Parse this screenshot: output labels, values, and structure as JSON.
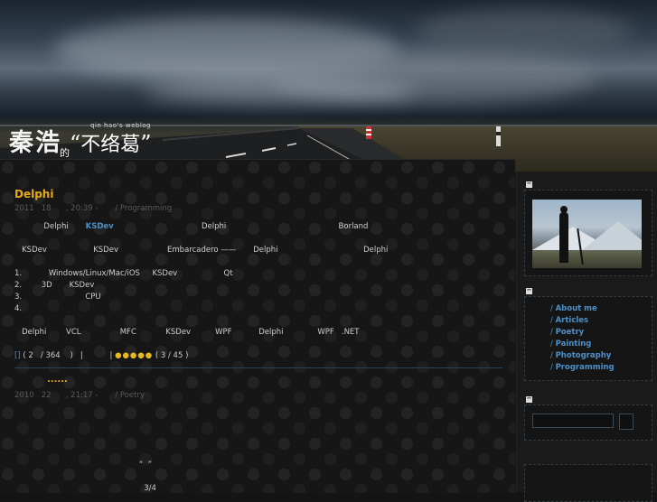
{
  "header": {
    "logo_name": "秦浩",
    "logo_de": "的",
    "logo_quote_open": "“",
    "logo_title": "不络葛",
    "logo_quote_close": "”",
    "logo_subtitle": "qin hao's weblog"
  },
  "posts": [
    {
      "title": "Delphi",
      "meta": "2011   18      , 20:39 -       / Programming",
      "lines": [
        {
          "segments": [
            {
              "text": "            Delphi       "
            },
            {
              "text": "KSDev",
              "link": true
            },
            {
              "text": "                                    Delphi                                              Borland"
            }
          ]
        },
        {
          "segments": [
            {
              "text": "   KSDev                   KSDev                    Embarcadero ——       Delphi                                   Delphi"
            }
          ]
        },
        {
          "segments": [
            {
              "text": "1.           Windows/Linux/Mac/iOS     KSDev                   Qt"
            }
          ]
        },
        {
          "segments": [
            {
              "text": "2.        3D       KSDev"
            }
          ]
        },
        {
          "segments": [
            {
              "text": "3.                          CPU"
            }
          ]
        },
        {
          "segments": [
            {
              "text": "4."
            }
          ]
        },
        {
          "segments": [
            {
              "text": "   Delphi        VCL                MFC            KSDev          WPF           Delphi              WPF   .NET"
            }
          ]
        }
      ],
      "footer_open": "[",
      "footer_close": "]",
      "footer_comments": " ( 2   / 364    )   |           | ",
      "rating_stars": "●●●●●",
      "rating_text": " ( 3 / 45 )"
    },
    {
      "title": "......",
      "meta": "2010   22      , 21:17 -       / Poetry",
      "lines": [
        {
          "segments": [
            {
              "text": "                                                   “  ”"
            }
          ]
        },
        {
          "segments": [
            {
              "text": "                                                     3/4"
            }
          ]
        }
      ]
    }
  ],
  "sidebar": {
    "toggle_symbol": "−",
    "categories": [
      "About me",
      "Articles",
      "Poetry",
      "Painting",
      "Photography",
      "Programming"
    ],
    "category_prefix": "/ "
  },
  "colors": {
    "accent": "#e8a918",
    "link": "#4f8fc8",
    "background": "#141414"
  }
}
